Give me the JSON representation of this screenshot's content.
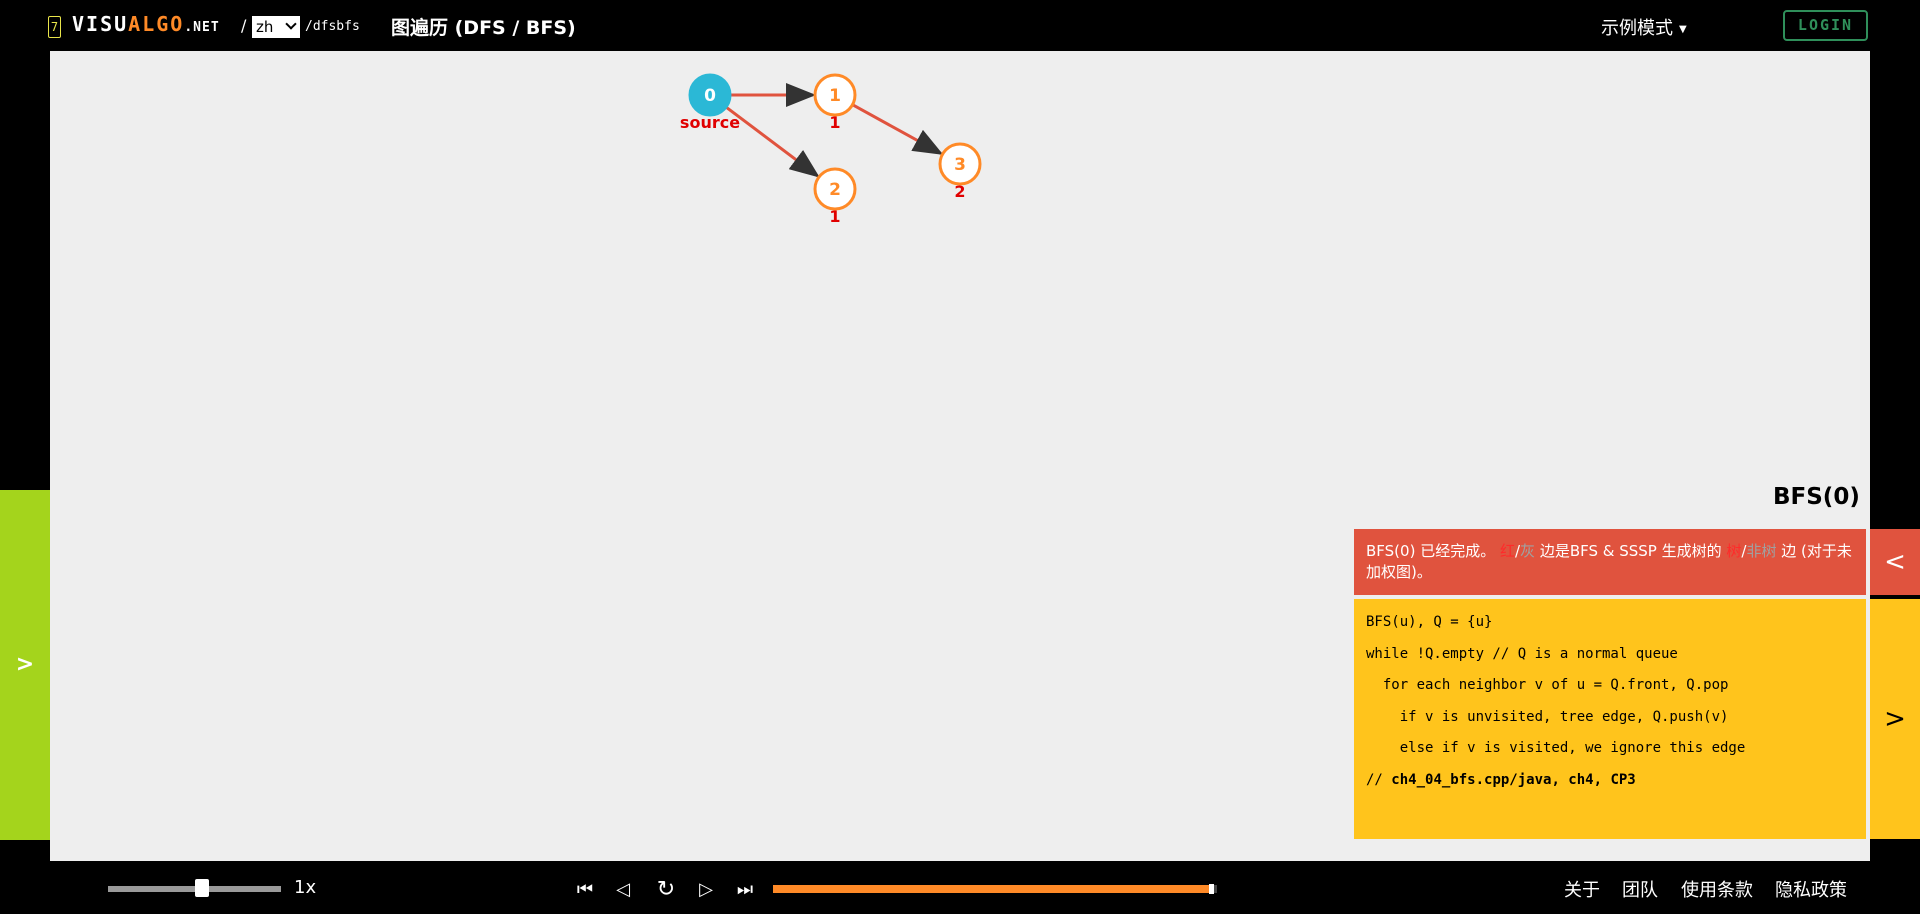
{
  "header": {
    "logo_digit": "7",
    "brand_white": "VISU",
    "brand_orange": "ALGO",
    "brand_net": ".NET",
    "separator": "/",
    "language": "zh",
    "path": "/dfsbfs",
    "title": "图遍历 (DFS / BFS)",
    "mode": "示例模式",
    "login": "LOGIN"
  },
  "graph": {
    "nodes": [
      {
        "id": "0",
        "label": "source",
        "type": "source"
      },
      {
        "id": "1",
        "label": "1",
        "type": "visited"
      },
      {
        "id": "2",
        "label": "1",
        "type": "visited"
      },
      {
        "id": "3",
        "label": "2",
        "type": "visited"
      }
    ],
    "edges": [
      {
        "from": "0",
        "to": "1"
      },
      {
        "from": "0",
        "to": "2"
      },
      {
        "from": "1",
        "to": "3"
      }
    ]
  },
  "status": {
    "title": "BFS(0)",
    "part1": "BFS(0) 已经完成。 ",
    "red_word": "红",
    "slash1": "/",
    "grey_word": "灰",
    "part2": " 边是BFS & SSSP 生成树的 ",
    "tree_word": "树",
    "slash2": "/",
    "nontree_word": "非树",
    "part3": " 边 (对于未加权图)。"
  },
  "code": {
    "lines": [
      "BFS(u), Q = {u}",
      "while !Q.empty // Q is a normal queue",
      "  for each neighbor v of u = Q.front, Q.pop",
      "    if v is unvisited, tree edge, Q.push(v)",
      "    else if v is visited, we ignore this edge"
    ],
    "ref_prefix": "// ",
    "ref_bold": "ch4_04_bfs.cpp/java, ch4, CP3"
  },
  "controls": {
    "left_toggle": ">",
    "prev": "<",
    "next": ">",
    "speed": "1x",
    "speed_fraction": 0.55,
    "progress_fraction": 0.985
  },
  "footer": {
    "about": "关于",
    "team": "团队",
    "terms": "使用条款",
    "privacy": "隐私政策"
  },
  "colors": {
    "source_node": "#2bb8d6",
    "visited_node": "#ff8a27",
    "tree_edge": "#e0533e",
    "label_red": "#e00000"
  }
}
